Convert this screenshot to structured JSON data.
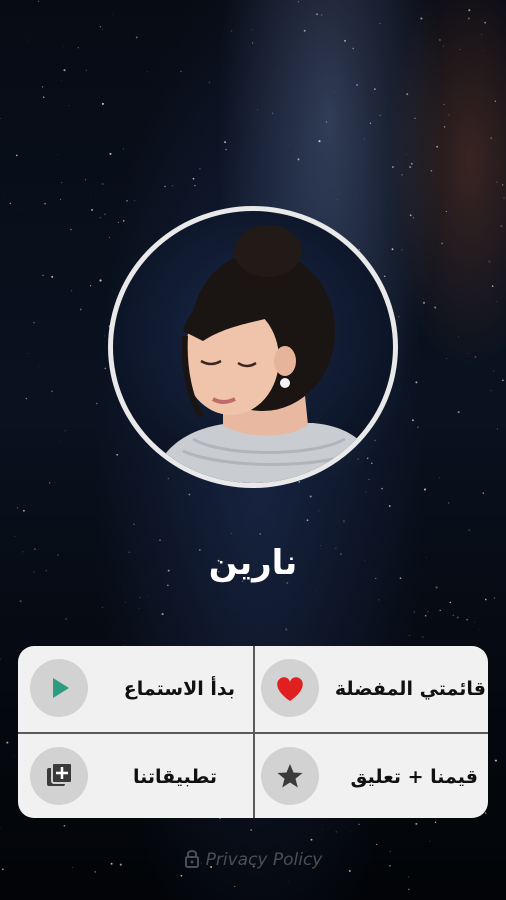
{
  "profile": {
    "name": "نارين"
  },
  "menu": {
    "start_listening": {
      "label": "بدأ الاستماع",
      "icon": "play-icon"
    },
    "my_favorites": {
      "label": "قائمتي المفضلة",
      "icon": "heart-icon"
    },
    "our_apps": {
      "label": "تطبيقاتنا",
      "icon": "add-library-icon"
    },
    "rate_us": {
      "label": "قيمنا + تعليق",
      "icon": "star-icon"
    }
  },
  "footer": {
    "privacy_label": "Privacy Policy",
    "icon": "lock-icon"
  },
  "colors": {
    "play": "#2e9c80",
    "heart": "#e02020",
    "icon_dark": "#3a3a3a",
    "panel": "#f1f1f1"
  }
}
